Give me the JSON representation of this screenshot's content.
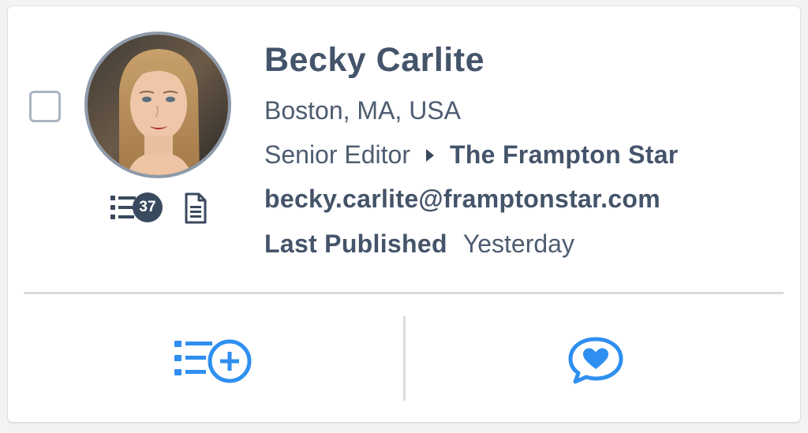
{
  "profile": {
    "name": "Becky Carlite",
    "location": "Boston, MA, USA",
    "role": "Senior Editor",
    "organization": "The Frampton Star",
    "email": "becky.carlite@framptonstar.com",
    "last_published_label": "Last Published",
    "last_published_value": "Yesterday"
  },
  "meta": {
    "list_count": "37",
    "list_icon": "list-icon",
    "document_icon": "document-icon"
  },
  "actions": {
    "add_to_list_icon": "list-add-icon",
    "favorite_icon": "heart-chat-icon"
  },
  "colors": {
    "text": "#44546a",
    "accent": "#2f8ff0",
    "badge": "#3a4a5e",
    "divider": "#d7dade"
  }
}
